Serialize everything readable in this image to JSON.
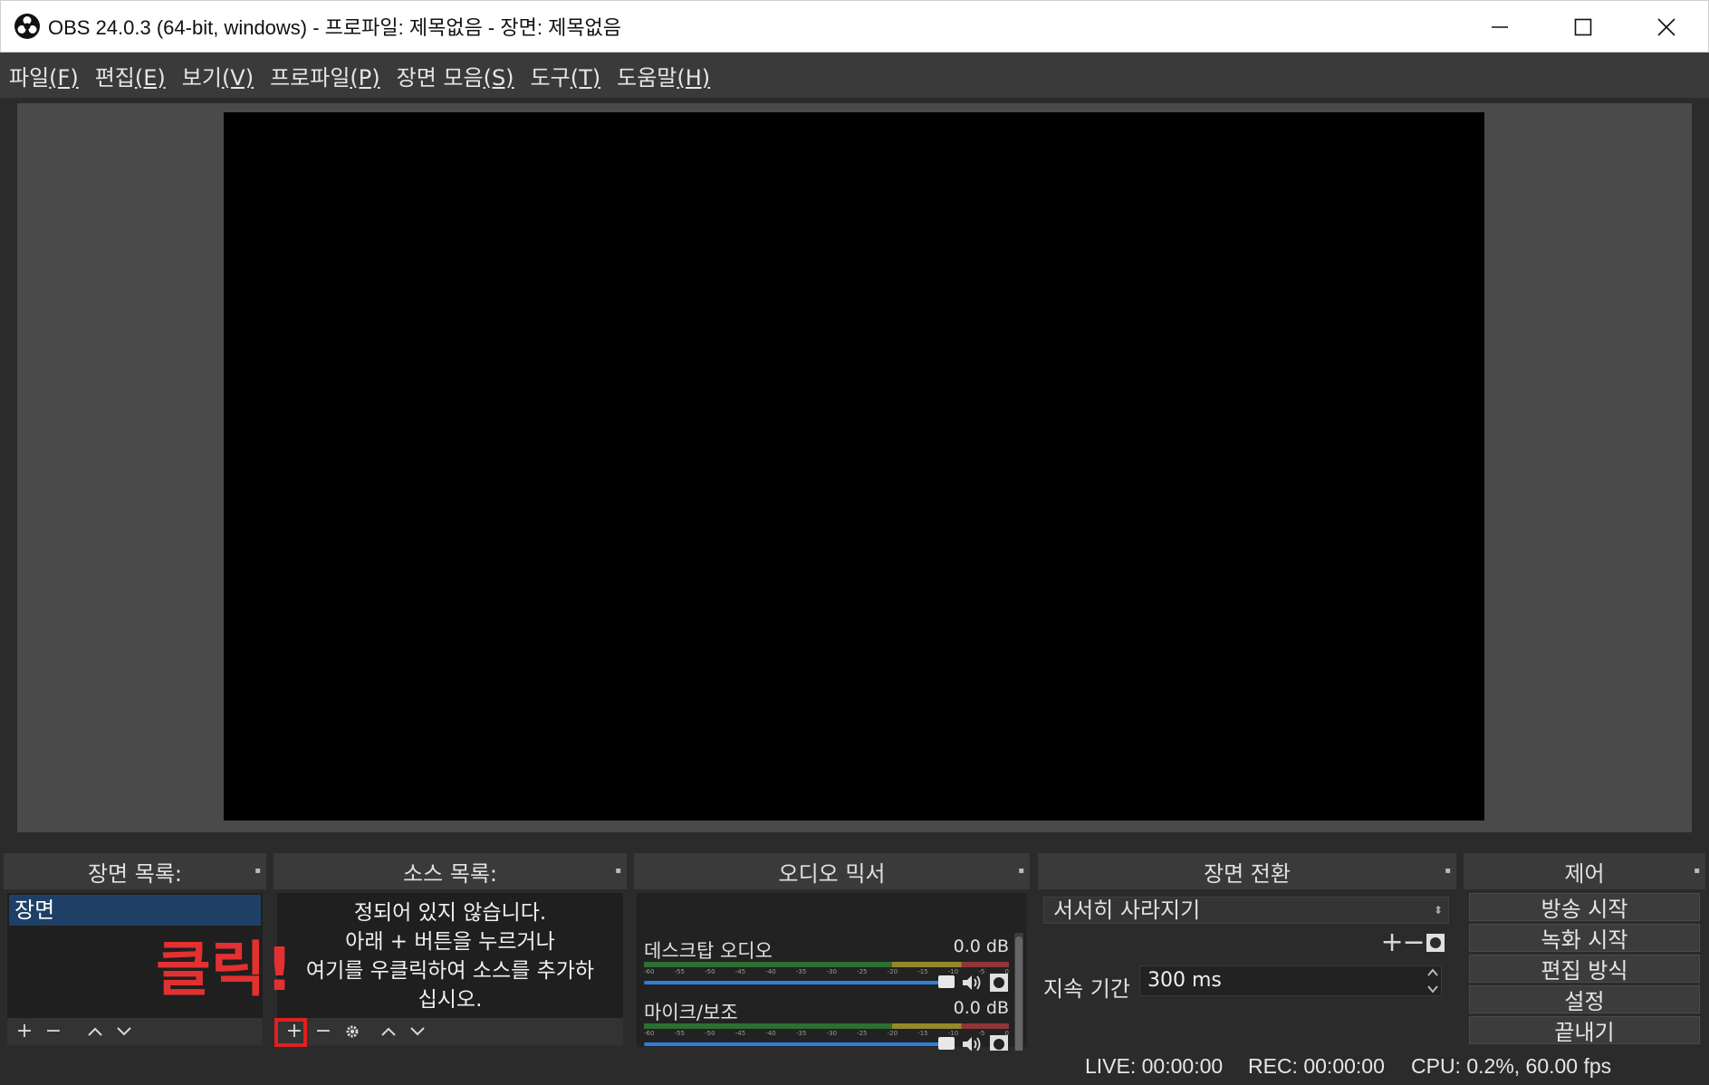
{
  "window": {
    "title": "OBS 24.0.3 (64-bit, windows) - 프로파일: 제목없음 - 장면: 제목없음"
  },
  "menu": [
    {
      "label": "파일",
      "accel": "(F)"
    },
    {
      "label": "편집",
      "accel": "(E)"
    },
    {
      "label": "보기",
      "accel": "(V)"
    },
    {
      "label": "프로파일",
      "accel": "(P)"
    },
    {
      "label": "장면 모음",
      "accel": "(S)"
    },
    {
      "label": "도구",
      "accel": "(T)"
    },
    {
      "label": "도움말",
      "accel": "(H)"
    }
  ],
  "scenes": {
    "title": "장면 목록:",
    "items": [
      "장면"
    ]
  },
  "sources": {
    "title": "소스 목록:",
    "empty_lines": [
      "정되어 있지 않습니다.",
      "아래 + 버튼을 누르거나",
      "여기를 우클릭하여 소스를 추가하",
      "십시오."
    ]
  },
  "annotation": {
    "text": "클릭!"
  },
  "mixer": {
    "title": "오디오 믹서",
    "channels": [
      {
        "name": "데스크탑 오디오",
        "db": "0.0 dB",
        "volume": 0.97
      },
      {
        "name": "마이크/보조",
        "db": "0.0 dB",
        "volume": 0.97
      }
    ],
    "ticks": [
      "-60",
      "-55",
      "-50",
      "-45",
      "-40",
      "-35",
      "-30",
      "-25",
      "-20",
      "-15",
      "-10",
      "-5",
      "0"
    ]
  },
  "transitions": {
    "title": "장면 전환",
    "selected": "서서히 사라지기",
    "duration_label": "지속 기간",
    "duration_value": "300 ms"
  },
  "controls": {
    "title": "제어",
    "buttons": [
      "방송 시작",
      "녹화 시작",
      "편집 방식",
      "설정",
      "끝내기"
    ]
  },
  "status": {
    "live": "LIVE: 00:00:00",
    "rec": "REC: 00:00:00",
    "cpu": "CPU: 0.2%, 60.00 fps"
  },
  "colors": {
    "accent": "#1e3f66",
    "slider": "#2f7fd6",
    "annotation": "#e02020"
  }
}
